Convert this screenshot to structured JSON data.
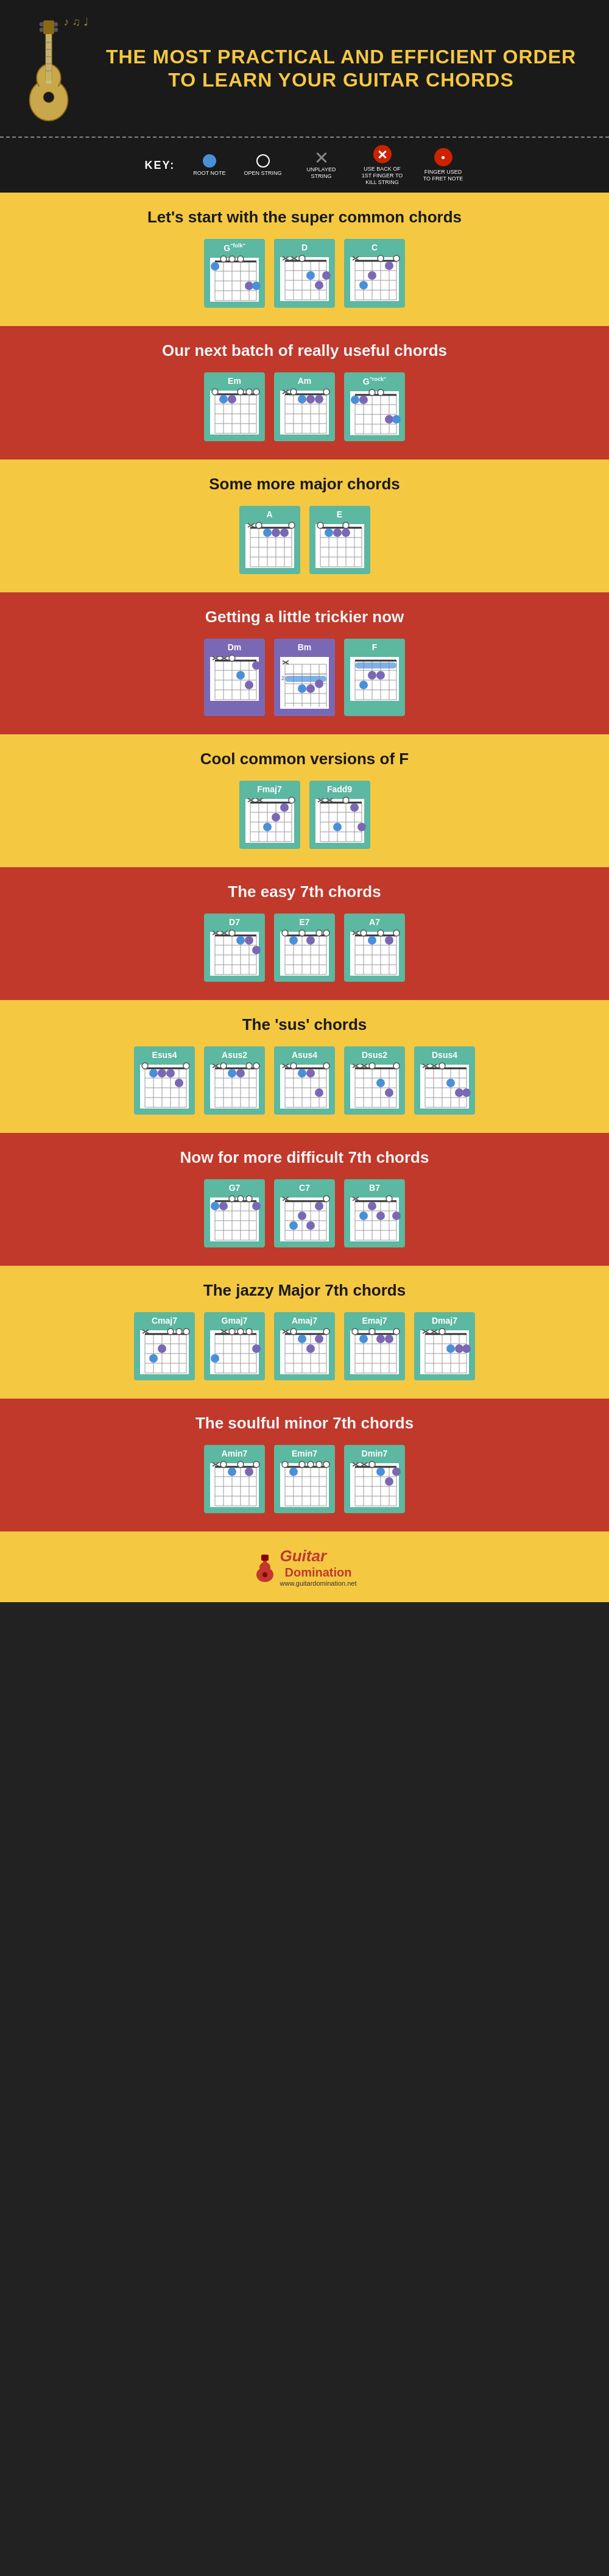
{
  "header": {
    "title": "THE MOST PRACTICAL AND EFFICIENT ORDER TO LEARN YOUR GUITAR CHORDS"
  },
  "key": {
    "label": "KEY:",
    "items": [
      {
        "id": "root-note",
        "type": "root",
        "label": "ROOT NOTE"
      },
      {
        "id": "open-string",
        "type": "open",
        "label": "OPEN STRING"
      },
      {
        "id": "unplayed",
        "type": "x",
        "label": "UNPLAYED STRING"
      },
      {
        "id": "kill",
        "type": "kill",
        "label": "USE BACK OF 1ST FINGER TO KILL STRING"
      },
      {
        "id": "fret",
        "type": "fret",
        "label": "FINGER USED TO FRET NOTE"
      }
    ]
  },
  "sections": [
    {
      "id": "super-common",
      "bg": "yellow",
      "title": "Let's start with the super common chords",
      "chords": [
        "G",
        "D",
        "C"
      ]
    },
    {
      "id": "really-useful",
      "bg": "red",
      "title": "Our next batch of really useful chords",
      "chords": [
        "Em",
        "Am",
        "G"
      ]
    },
    {
      "id": "major",
      "bg": "yellow",
      "title": "Some more major chords",
      "chords": [
        "A",
        "E"
      ]
    },
    {
      "id": "trickier",
      "bg": "red",
      "title": "Getting a little trickier now",
      "chords": [
        "Dm",
        "Bm",
        "F"
      ]
    },
    {
      "id": "cool-f",
      "bg": "yellow",
      "title": "Cool common versions of F",
      "chords": [
        "Fmaj7",
        "Fadd9"
      ]
    },
    {
      "id": "easy-7th",
      "bg": "red",
      "title": "The easy 7th chords",
      "chords": [
        "D7",
        "E7",
        "A7"
      ]
    },
    {
      "id": "sus",
      "bg": "yellow",
      "title": "The 'sus' chords",
      "chords": [
        "Esus4",
        "Asus2",
        "Asus4",
        "Dsus2",
        "Dsus4"
      ]
    },
    {
      "id": "difficult-7th",
      "bg": "red",
      "title": "Now for more difficult 7th chords",
      "chords": [
        "G7",
        "C7",
        "B7"
      ]
    },
    {
      "id": "jazzy",
      "bg": "yellow",
      "title": "The jazzy Major 7th chords",
      "chords": [
        "Cmaj7",
        "Gmaj7",
        "Amaj7",
        "Emaj7",
        "Dmaj7"
      ]
    },
    {
      "id": "soulful",
      "bg": "red",
      "title": "The soulful minor 7th chords",
      "chords": [
        "Amin7",
        "Emin7",
        "Dmin7"
      ]
    }
  ],
  "footer": {
    "logo_main": "Guitar",
    "logo_sub": "Domination",
    "url": "www.guitardomination.net"
  }
}
